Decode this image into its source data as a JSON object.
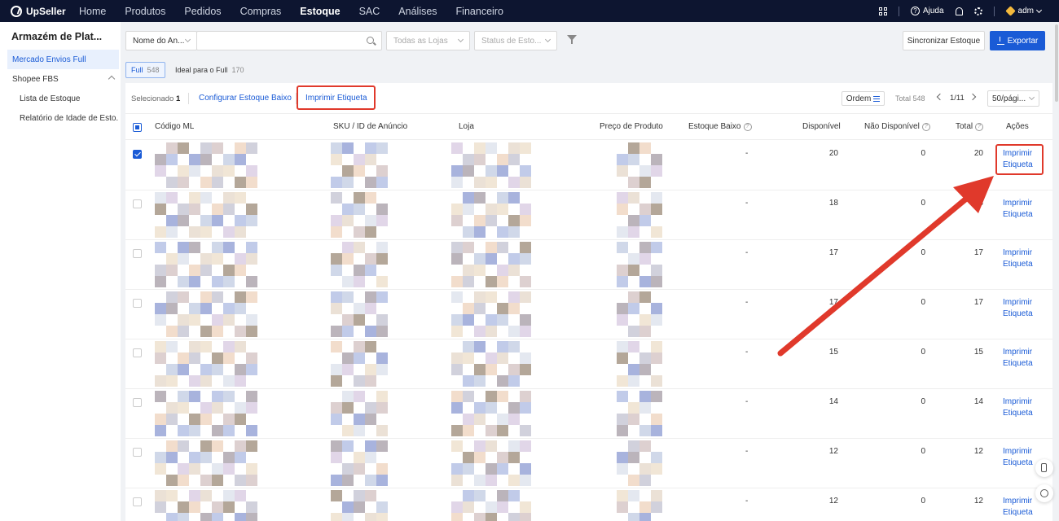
{
  "app": {
    "logo_text": "UpSeller"
  },
  "nav": {
    "items": [
      "Home",
      "Produtos",
      "Pedidos",
      "Compras",
      "Estoque",
      "SAC",
      "Análises",
      "Financeiro"
    ],
    "active": "Estoque"
  },
  "topbar": {
    "help_label": "Ajuda",
    "user_label": "adm",
    "icons": [
      "apps-grid-icon",
      "help-icon",
      "bell-icon",
      "gear-icon",
      "diamond-icon"
    ]
  },
  "sidebar": {
    "title": "Armazém de Plat...",
    "items": [
      {
        "label": "Mercado Envios Full",
        "active": true
      },
      {
        "label": "Shopee FBS",
        "expandable": true
      },
      {
        "label": "Lista de Estoque",
        "sub": true
      },
      {
        "label": "Relatório de Idade de Esto...",
        "sub": true
      }
    ]
  },
  "filters": {
    "search_field_select": "Nome do An...",
    "search_value": "",
    "store_placeholder": "Todas as Lojas",
    "status_placeholder": "Status de Esto...",
    "sync_label": "Sincronizar Estoque",
    "export_label": "Exportar"
  },
  "chips": [
    {
      "label": "Full",
      "count": "548",
      "active": true
    },
    {
      "label": "Ideal para o Full",
      "count": "170",
      "active": false
    }
  ],
  "actionbar": {
    "selected_label": "Selecionado",
    "selected_count": "1",
    "config_low_stock": "Configurar Estoque Baixo",
    "print_label": "Imprimir Etiqueta",
    "order_label": "Ordem",
    "total_label": "Total 548",
    "page_label": "1/11",
    "page_size": "50/pági..."
  },
  "table": {
    "columns": [
      "Código ML",
      "SKU / ID de Anúncio",
      "Loja",
      "Preço de Produto",
      "Estoque Baixo",
      "Disponível",
      "Não Disponível",
      "Total",
      "Ações"
    ],
    "rows": [
      {
        "checked": true,
        "low_stock": "-",
        "available": "20",
        "unavailable": "0",
        "total": "20",
        "action_line1": "Imprimir",
        "action_line2": "Etiqueta"
      },
      {
        "checked": false,
        "low_stock": "-",
        "available": "18",
        "unavailable": "0",
        "total": "18",
        "action_line1": "Imprimir",
        "action_line2": "Etiqueta"
      },
      {
        "checked": false,
        "low_stock": "-",
        "available": "17",
        "unavailable": "0",
        "total": "17",
        "action_line1": "Imprimir",
        "action_line2": "Etiqueta"
      },
      {
        "checked": false,
        "low_stock": "-",
        "available": "17",
        "unavailable": "0",
        "total": "17",
        "action_line1": "Imprimir",
        "action_line2": "Etiqueta"
      },
      {
        "checked": false,
        "low_stock": "-",
        "available": "15",
        "unavailable": "0",
        "total": "15",
        "action_line1": "Imprimir",
        "action_line2": "Etiqueta"
      },
      {
        "checked": false,
        "low_stock": "-",
        "available": "14",
        "unavailable": "0",
        "total": "14",
        "action_line1": "Imprimir",
        "action_line2": "Etiqueta"
      },
      {
        "checked": false,
        "low_stock": "-",
        "available": "12",
        "unavailable": "0",
        "total": "12",
        "action_line1": "Imprimir",
        "action_line2": "Etiqueta"
      },
      {
        "checked": false,
        "low_stock": "-",
        "available": "12",
        "unavailable": "0",
        "total": "12",
        "action_line1": "Imprimir",
        "action_line2": "Etiqueta"
      }
    ]
  },
  "annotation": {
    "highlight_color": "#e0392b"
  },
  "colors": {
    "primary": "#1a5bd6",
    "topbar": "#0d1530"
  }
}
